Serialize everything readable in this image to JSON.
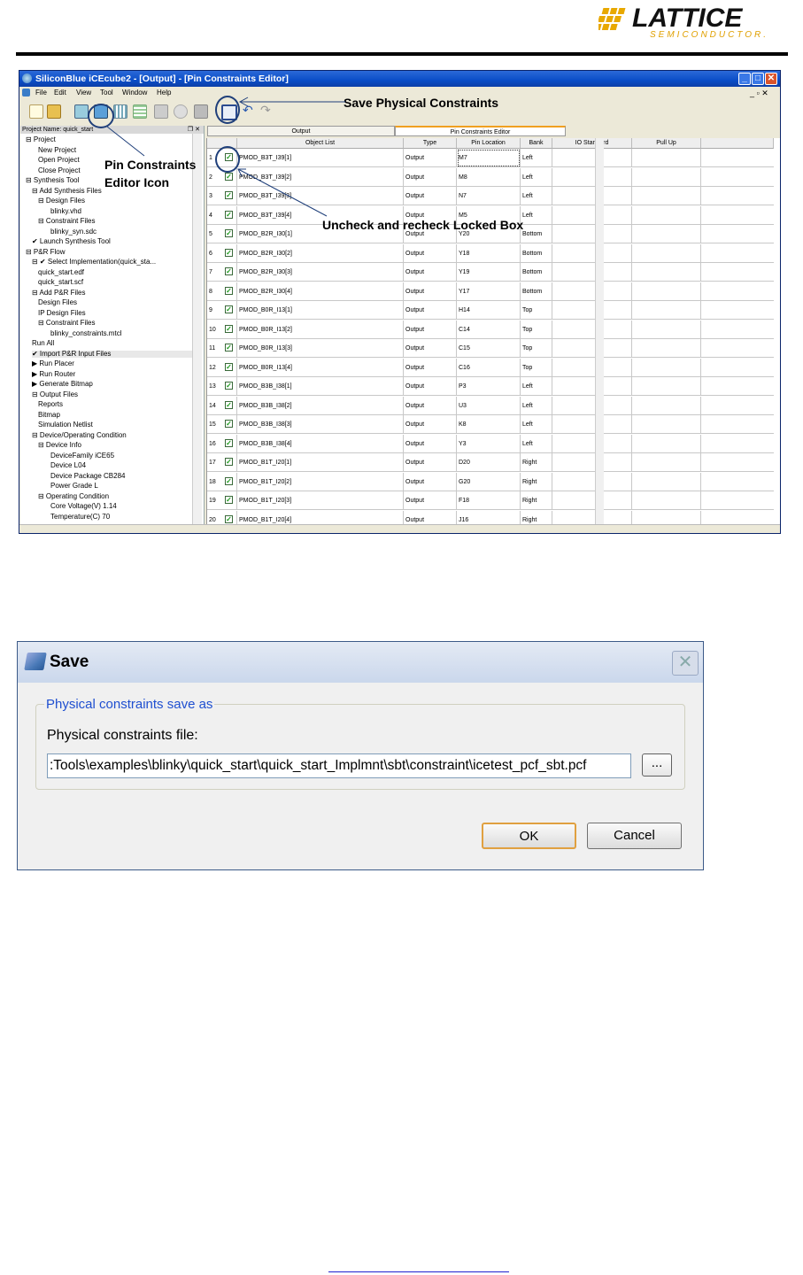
{
  "logo": {
    "word": "LATTICE",
    "sub": "SEMICONDUCTOR."
  },
  "window": {
    "title": "SiliconBlue iCEcube2 - [Output] - [Pin Constraints Editor]",
    "menu": [
      "File",
      "Edit",
      "View",
      "Tool",
      "Window",
      "Help"
    ],
    "tabs": [
      "Output",
      "Pin Constraints Editor"
    ],
    "project_header": "Project Name: quick_start",
    "panel_controls": "❐ ✕"
  },
  "tree": [
    {
      "t": "⊟ Project",
      "d": 0
    },
    {
      "t": "New Project",
      "d": 2
    },
    {
      "t": "Open Project",
      "d": 2
    },
    {
      "t": "Close Project",
      "d": 2
    },
    {
      "t": "⊟ Synthesis Tool",
      "d": 0
    },
    {
      "t": "⊟ Add Synthesis Files",
      "d": 1
    },
    {
      "t": "⊟ Design Files",
      "d": 2
    },
    {
      "t": "blinky.vhd",
      "d": 4
    },
    {
      "t": "⊟ Constraint Files",
      "d": 2
    },
    {
      "t": "blinky_syn.sdc",
      "d": 4
    },
    {
      "t": "✔ Launch Synthesis Tool",
      "d": 1
    },
    {
      "t": "⊟ P&R Flow",
      "d": 0
    },
    {
      "t": "⊟ ✔ Select Implementation(quick_sta...",
      "d": 1
    },
    {
      "t": "quick_start.edf",
      "d": 2
    },
    {
      "t": "quick_start.scf",
      "d": 2
    },
    {
      "t": "⊟ Add P&R Files",
      "d": 1
    },
    {
      "t": "Design Files",
      "d": 2
    },
    {
      "t": "IP Design Files",
      "d": 2
    },
    {
      "t": "⊟ Constraint Files",
      "d": 2
    },
    {
      "t": "blinky_constraints.mtcl",
      "d": 4
    },
    {
      "t": "Run All",
      "d": 1
    },
    {
      "t": "✔ Import P&R Input Files",
      "d": 1
    },
    {
      "t": "▶ Run Placer",
      "d": 1
    },
    {
      "t": "▶ Run Router",
      "d": 1
    },
    {
      "t": "▶ Generate Bitmap",
      "d": 1
    },
    {
      "t": "⊟ Output Files",
      "d": 1
    },
    {
      "t": "Reports",
      "d": 2
    },
    {
      "t": "Bitmap",
      "d": 2
    },
    {
      "t": "Simulation Netlist",
      "d": 2
    },
    {
      "t": "⊟ Device/Operating Condition",
      "d": 1
    },
    {
      "t": "⊟ Device Info",
      "d": 2
    },
    {
      "t": "DeviceFamily     iCE65",
      "d": 4
    },
    {
      "t": "Device              L04",
      "d": 4
    },
    {
      "t": "Device Package   CB284",
      "d": 4
    },
    {
      "t": "Power Grade       L",
      "d": 4
    },
    {
      "t": "⊟ Operating Condition",
      "d": 2
    },
    {
      "t": "Core Voltage(V)    1.14",
      "d": 4
    },
    {
      "t": "Temperature(C)    70",
      "d": 4
    }
  ],
  "grid": {
    "headers": [
      "",
      "Object List",
      "Type",
      "Pin Location",
      "Bank",
      "IO Standard",
      "Pull Up"
    ],
    "check_mark": "✓",
    "rows": [
      {
        "n": "1",
        "obj": "PMOD_B3T_I39[1]",
        "type": "Output",
        "pin": "M7",
        "bank": "Left"
      },
      {
        "n": "2",
        "obj": "PMOD_B3T_I39[2]",
        "type": "Output",
        "pin": "M8",
        "bank": "Left"
      },
      {
        "n": "3",
        "obj": "PMOD_B3T_I39[3]",
        "type": "Output",
        "pin": "N7",
        "bank": "Left"
      },
      {
        "n": "4",
        "obj": "PMOD_B3T_I39[4]",
        "type": "Output",
        "pin": "M5",
        "bank": "Left"
      },
      {
        "n": "5",
        "obj": "PMOD_B2R_I30[1]",
        "type": "Output",
        "pin": "Y20",
        "bank": "Bottom"
      },
      {
        "n": "6",
        "obj": "PMOD_B2R_I30[2]",
        "type": "Output",
        "pin": "Y18",
        "bank": "Bottom"
      },
      {
        "n": "7",
        "obj": "PMOD_B2R_I30[3]",
        "type": "Output",
        "pin": "Y19",
        "bank": "Bottom"
      },
      {
        "n": "8",
        "obj": "PMOD_B2R_I30[4]",
        "type": "Output",
        "pin": "Y17",
        "bank": "Bottom"
      },
      {
        "n": "9",
        "obj": "PMOD_B0R_I13[1]",
        "type": "Output",
        "pin": "H14",
        "bank": "Top"
      },
      {
        "n": "10",
        "obj": "PMOD_B0R_I13[2]",
        "type": "Output",
        "pin": "C14",
        "bank": "Top"
      },
      {
        "n": "11",
        "obj": "PMOD_B0R_I13[3]",
        "type": "Output",
        "pin": "C15",
        "bank": "Top"
      },
      {
        "n": "12",
        "obj": "PMOD_B0R_I13[4]",
        "type": "Output",
        "pin": "C16",
        "bank": "Top"
      },
      {
        "n": "13",
        "obj": "PMOD_B3B_I38[1]",
        "type": "Output",
        "pin": "P3",
        "bank": "Left"
      },
      {
        "n": "14",
        "obj": "PMOD_B3B_I38[2]",
        "type": "Output",
        "pin": "U3",
        "bank": "Left"
      },
      {
        "n": "15",
        "obj": "PMOD_B3B_I38[3]",
        "type": "Output",
        "pin": "K8",
        "bank": "Left"
      },
      {
        "n": "16",
        "obj": "PMOD_B3B_I38[4]",
        "type": "Output",
        "pin": "Y3",
        "bank": "Left"
      },
      {
        "n": "17",
        "obj": "PMOD_B1T_I20[1]",
        "type": "Output",
        "pin": "D20",
        "bank": "Right"
      },
      {
        "n": "18",
        "obj": "PMOD_B1T_I20[2]",
        "type": "Output",
        "pin": "G20",
        "bank": "Right"
      },
      {
        "n": "19",
        "obj": "PMOD_B1T_I20[3]",
        "type": "Output",
        "pin": "F18",
        "bank": "Right"
      },
      {
        "n": "20",
        "obj": "PMOD_B1T_I20[4]",
        "type": "Output",
        "pin": "J16",
        "bank": "Right"
      }
    ]
  },
  "annotations": {
    "save": "Save Physical Constraints",
    "pin_editor": "Pin Constraints\nEditor Icon",
    "uncheck": "Uncheck and recheck Locked Box"
  },
  "dialog": {
    "title": "Save",
    "close": "✕",
    "group_label": "Physical constraints save as",
    "file_label": "Physical constraints file:",
    "file_path": ":Tools\\examples\\blinky\\quick_start\\quick_start_Implmnt\\sbt\\constraint\\icetest_pcf_sbt.pcf",
    "browse": "...",
    "ok": "OK",
    "cancel": "Cancel"
  }
}
